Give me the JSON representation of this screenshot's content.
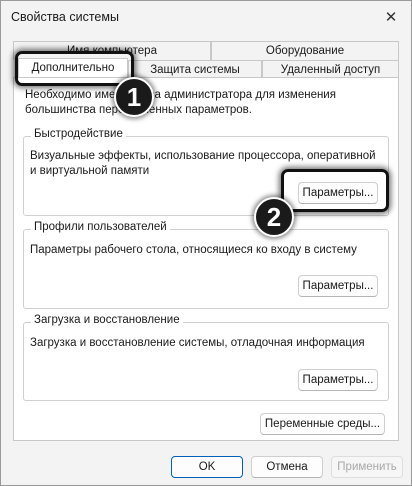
{
  "window": {
    "title": "Свойства системы",
    "close_icon": "close-icon"
  },
  "tabs": {
    "row1": [
      "Имя компьютера",
      "Оборудование"
    ],
    "row2": [
      "Дополнительно",
      "Защита системы",
      "Удаленный доступ"
    ],
    "active": "Дополнительно"
  },
  "admin_notice": "Необходимо иметь права администратора для изменения большинства перечисленных параметров.",
  "performance": {
    "title": "Быстродействие",
    "description": "Визуальные эффекты, использование процессора, оперативной и виртуальной памяти",
    "button": "Параметры..."
  },
  "user_profiles": {
    "title": "Профили пользователей",
    "description": "Параметры рабочего стола, относящиеся ко входу в систему",
    "button": "Параметры..."
  },
  "startup_recovery": {
    "title": "Загрузка и восстановление",
    "description": "Загрузка и восстановление системы, отладочная информация",
    "button": "Параметры..."
  },
  "env_vars_button": "Переменные среды...",
  "footer": {
    "ok": "OK",
    "cancel": "Отмена",
    "apply": "Применить"
  },
  "annotations": {
    "badge1": "1",
    "badge2": "2"
  }
}
